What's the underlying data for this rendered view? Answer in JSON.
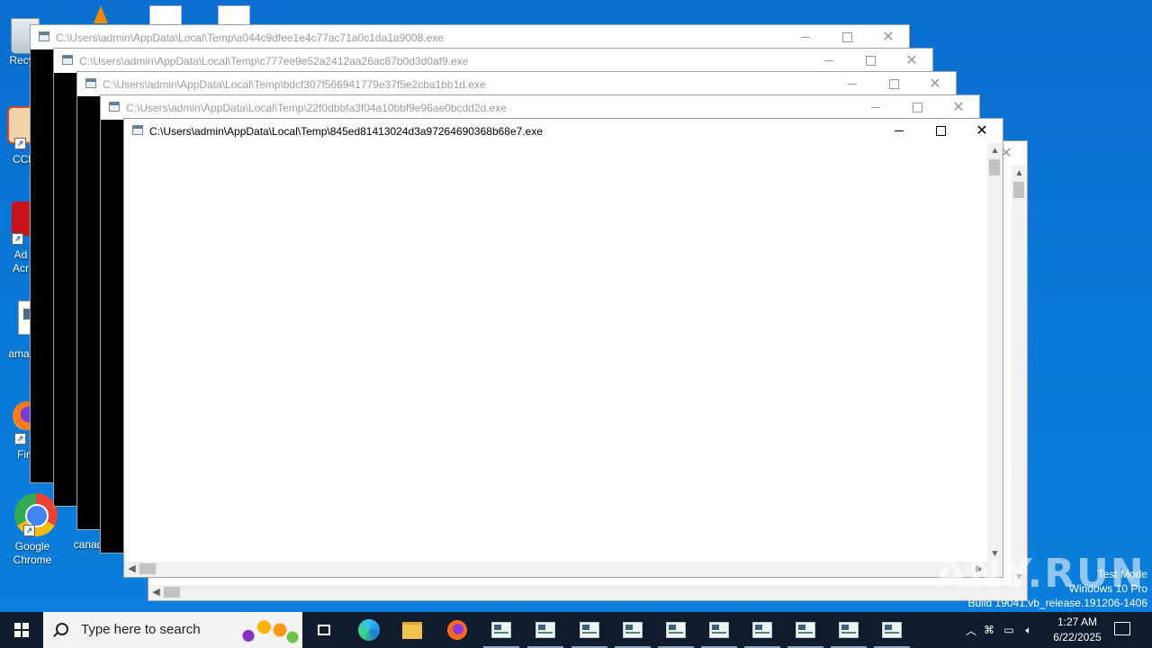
{
  "desktop": {
    "icons": [
      {
        "label": "Recy"
      },
      {
        "label": "CCl"
      },
      {
        "label": "Ad Acr"
      },
      {
        "label": "amate"
      },
      {
        "label": "Fir"
      },
      {
        "label": "Google Chrome"
      },
      {
        "label": "canad"
      }
    ]
  },
  "windows": [
    {
      "title": "C:\\Users\\admin\\AppData\\Local\\Temp\\a044c9dfee1e4c77ac71a0c1da1a9008.exe"
    },
    {
      "title": "C:\\Users\\admin\\AppData\\Local\\Temp\\c777ee9e52a2412aa26ac87b0d3d0af9.exe"
    },
    {
      "title": "C:\\Users\\admin\\AppData\\Local\\Temp\\bdcf307f566941779e37f5e2cba1bb1d.exe"
    },
    {
      "title": "C:\\Users\\admin\\AppData\\Local\\Temp\\22f0dbbfa3f04a10bbf9e96ae0bcdd2d.exe"
    },
    {
      "title": "C:\\Users\\admin\\AppData\\Local\\Temp\\845ed81413024d3a97264690368b68e7.exe"
    }
  ],
  "watermark": {
    "brand": "ANY.RUN",
    "test_mode": "Test Mode",
    "edition": "Windows 10 Pro",
    "build": "Build 19041.vb_release.191206-1406"
  },
  "taskbar": {
    "search_placeholder": "Type here to search",
    "pinned": [
      "task-view",
      "edge",
      "file-explorer",
      "firefox"
    ],
    "console_buttons": 10,
    "clock_time": "1:27 AM",
    "clock_date": "6/22/2025"
  },
  "colors": {
    "desktop": "#0a78d6",
    "taskbar": "#101c2b"
  }
}
